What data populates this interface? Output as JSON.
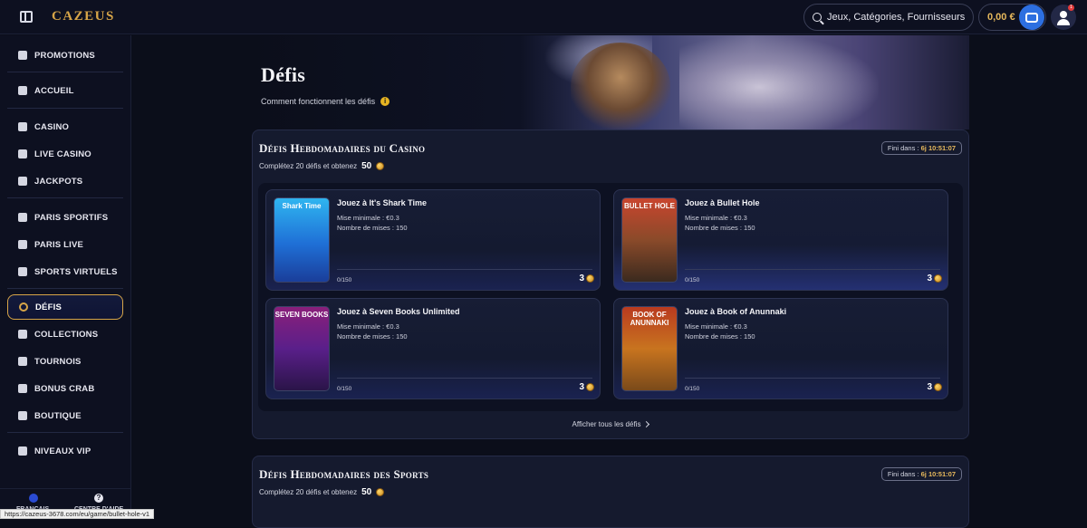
{
  "header": {
    "logo": "CAZEUS",
    "search_placeholder": "Jeux, Catégories, Fournisseurs",
    "balance": "0,00 €",
    "notification_count": "1"
  },
  "sidebar": {
    "items": [
      {
        "label": "PROMOTIONS",
        "icon": "gift-icon"
      },
      {
        "label": "ACCUEIL",
        "icon": "temple-icon"
      },
      {
        "label": "CASINO",
        "icon": "slot-machine-icon"
      },
      {
        "label": "LIVE CASINO",
        "icon": "cards-icon"
      },
      {
        "label": "JACKPOTS",
        "icon": "jackpot-icon"
      },
      {
        "label": "PARIS SPORTIFS",
        "icon": "ball-icon"
      },
      {
        "label": "PARIS LIVE",
        "icon": "live-scoreboard-icon"
      },
      {
        "label": "SPORTS VIRTUELS",
        "icon": "gamepad-icon"
      },
      {
        "label": "DÉFIS",
        "icon": "challenge-icon",
        "active": true
      },
      {
        "label": "COLLECTIONS",
        "icon": "collections-icon"
      },
      {
        "label": "TOURNOIS",
        "icon": "trophy-icon"
      },
      {
        "label": "BONUS CRAB",
        "icon": "crab-icon"
      },
      {
        "label": "BOUTIQUE",
        "icon": "shop-icon"
      },
      {
        "label": "NIVEAUX VIP",
        "icon": "diamond-icon"
      }
    ],
    "footer": {
      "language": "FRANÇAIS",
      "help": "CENTRE D'AIDE"
    }
  },
  "status_url": "https://cazeus-3678.com/eu/game/bullet-hole-v1",
  "hero": {
    "title": "Défis",
    "how_it_works": "Comment fonctionnent les défis"
  },
  "casino_section": {
    "title": "Défis Hebdomadaires du Casino",
    "subtitle": "Complétez 20 défis et obtenez",
    "reward": "50",
    "timer_label": "Fini dans :",
    "timer_value": "6j 10:51:07",
    "cards": [
      {
        "title": "Jouez à It's Shark Time",
        "min_bet": "Mise minimale : €0.3",
        "bet_count": "Nombre de mises : 150",
        "progress": "0/150",
        "reward": "3",
        "thumb_label": "Shark Time",
        "thumb_color": "#1f8fd6"
      },
      {
        "title": "Jouez à Bullet Hole",
        "min_bet": "Mise minimale : €0.3",
        "bet_count": "Nombre de mises : 150",
        "progress": "0/150",
        "reward": "3",
        "thumb_label": "BULLET HOLE",
        "thumb_color": "#8a4a2a"
      },
      {
        "title": "Jouez à Seven Books Unlimited",
        "min_bet": "Mise minimale : €0.3",
        "bet_count": "Nombre de mises : 150",
        "progress": "0/150",
        "reward": "3",
        "thumb_label": "SEVEN BOOKS",
        "thumb_color": "#6b1f8a"
      },
      {
        "title": "Jouez à Book of Anunnaki",
        "min_bet": "Mise minimale : €0.3",
        "bet_count": "Nombre de mises : 150",
        "progress": "0/150",
        "reward": "3",
        "thumb_label": "BOOK OF ANUNNAKI",
        "thumb_color": "#b5641f"
      }
    ],
    "show_all": "Afficher tous les défis"
  },
  "sports_section": {
    "title": "Défis Hebdomadaires des Sports",
    "subtitle": "Complétez 20 défis et obtenez",
    "reward": "50",
    "timer_label": "Fini dans :",
    "timer_value": "6j 10:51:07"
  }
}
